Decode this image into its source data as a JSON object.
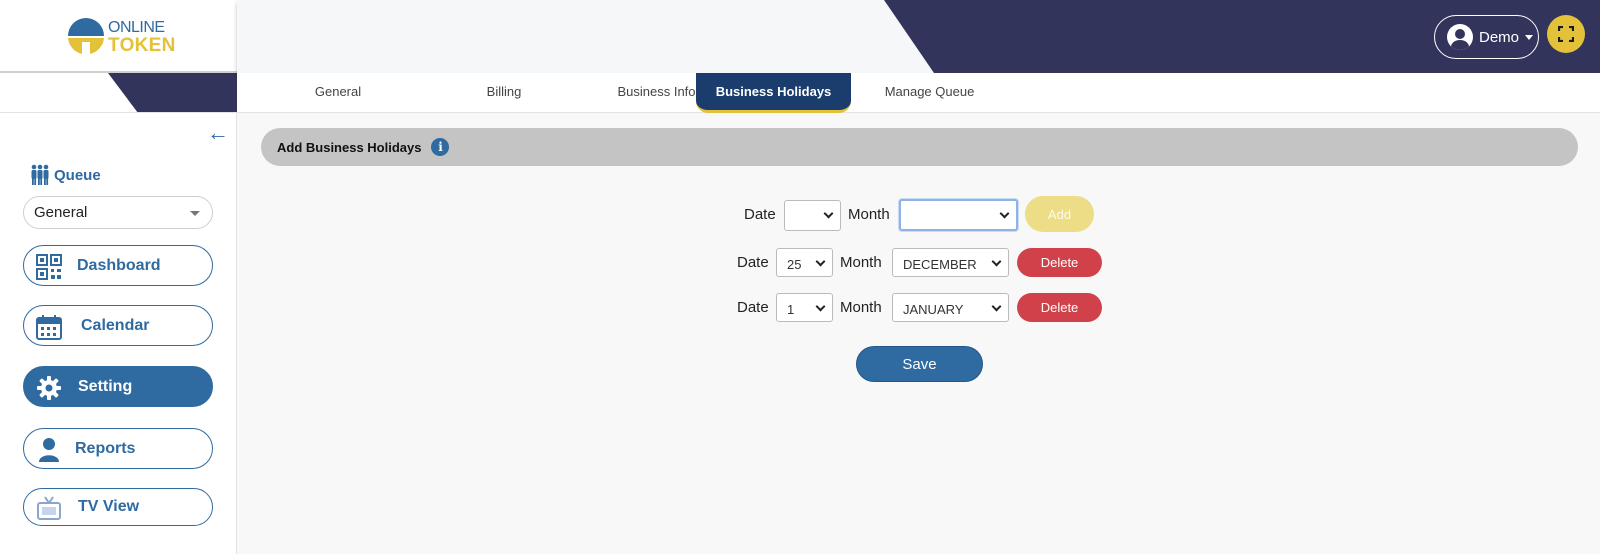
{
  "brand": {
    "line1": "ONLINE",
    "line2": "TOKEN"
  },
  "header": {
    "user_name": "Demo"
  },
  "sidebar": {
    "queue_label": "Queue",
    "queue_selected": "General",
    "items": [
      {
        "label": "Dashboard"
      },
      {
        "label": "Calendar"
      },
      {
        "label": "Setting"
      },
      {
        "label": "Reports"
      },
      {
        "label": "TV View"
      }
    ]
  },
  "tabs": [
    {
      "label": "General"
    },
    {
      "label": "Billing"
    },
    {
      "label": "Business Info"
    },
    {
      "label": "Business Holidays"
    },
    {
      "label": "Manage Queue"
    }
  ],
  "section": {
    "title": "Add Business Holidays",
    "info_glyph": "i"
  },
  "form": {
    "date_label": "Date",
    "month_label": "Month",
    "new_row": {
      "date": "",
      "month": "",
      "add_label": "Add"
    },
    "holidays": [
      {
        "date": "25",
        "month": "DECEMBER",
        "delete_label": "Delete"
      },
      {
        "date": "1",
        "month": "JANUARY",
        "delete_label": "Delete"
      }
    ],
    "save_label": "Save"
  },
  "colors": {
    "primary": "#2f6aa0",
    "navy": "#33345c",
    "accent_yellow": "#e3c23a",
    "danger": "#d1414a"
  }
}
